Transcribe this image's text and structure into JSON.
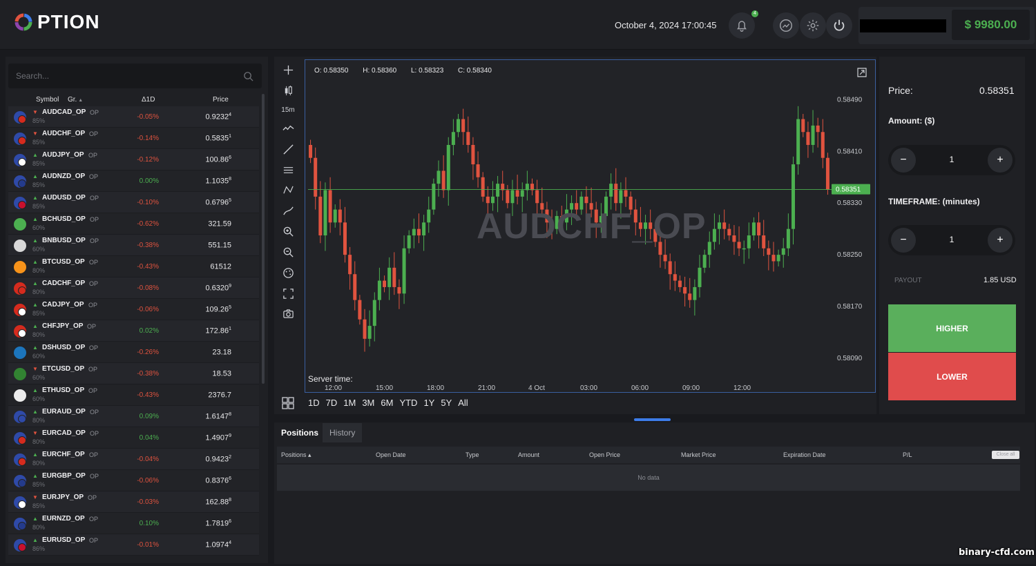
{
  "app": {
    "logo_text": "PTION",
    "datetime": "October 4, 2024 17:00:45",
    "notification_count": "4",
    "balance": "$ 9980.00"
  },
  "search": {
    "placeholder": "Search..."
  },
  "table": {
    "col_symbol": "Symbol",
    "col_group": "Gr.",
    "col_change": "Δ1D",
    "col_price": "Price"
  },
  "assets": [
    {
      "symbol": "AUDCAD_OP",
      "tag": "OP",
      "payout": "85%",
      "dir": "down",
      "change": "-0.05%",
      "price_main": "0.9232",
      "price_sup": "4",
      "flag_a": "#2f4aa8",
      "flag_b": "#d52b1e"
    },
    {
      "symbol": "AUDCHF_OP",
      "tag": "OP",
      "payout": "85%",
      "dir": "down",
      "change": "-0.14%",
      "price_main": "0.5835",
      "price_sup": "1",
      "flag_a": "#2f4aa8",
      "flag_b": "#d52b1e"
    },
    {
      "symbol": "AUDJPY_OP",
      "tag": "OP",
      "payout": "85%",
      "dir": "up",
      "change": "-0.12%",
      "price_main": "100.86",
      "price_sup": "6",
      "flag_a": "#2f4aa8",
      "flag_b": "#ffffff"
    },
    {
      "symbol": "AUDNZD_OP",
      "tag": "OP",
      "payout": "85%",
      "dir": "up",
      "change": "0.00%",
      "price_main": "1.1035",
      "price_sup": "8",
      "flag_a": "#2f4aa8",
      "flag_b": "#243b8c"
    },
    {
      "symbol": "AUDUSD_OP",
      "tag": "OP",
      "payout": "85%",
      "dir": "up",
      "change": "-0.10%",
      "price_main": "0.6796",
      "price_sup": "5",
      "flag_a": "#2f4aa8",
      "flag_b": "#c8102e"
    },
    {
      "symbol": "BCHUSD_OP",
      "tag": "OP",
      "payout": "60%",
      "dir": "up",
      "change": "-0.62%",
      "price_main": "321.59",
      "price_sup": "",
      "flag_a": "#4caf50",
      "flag_b": ""
    },
    {
      "symbol": "BNBUSD_OP",
      "tag": "OP",
      "payout": "60%",
      "dir": "up",
      "change": "-0.38%",
      "price_main": "551.15",
      "price_sup": "",
      "flag_a": "#d8d8d8",
      "flag_b": ""
    },
    {
      "symbol": "BTCUSD_OP",
      "tag": "OP",
      "payout": "80%",
      "dir": "up",
      "change": "-0.43%",
      "price_main": "61512",
      "price_sup": "",
      "flag_a": "#f7931a",
      "flag_b": ""
    },
    {
      "symbol": "CADCHF_OP",
      "tag": "OP",
      "payout": "80%",
      "dir": "up",
      "change": "-0.08%",
      "price_main": "0.6320",
      "price_sup": "9",
      "flag_a": "#d52b1e",
      "flag_b": "#d52b1e"
    },
    {
      "symbol": "CADJPY_OP",
      "tag": "OP",
      "payout": "85%",
      "dir": "up",
      "change": "-0.06%",
      "price_main": "109.26",
      "price_sup": "5",
      "flag_a": "#d52b1e",
      "flag_b": "#ffffff"
    },
    {
      "symbol": "CHFJPY_OP",
      "tag": "OP",
      "payout": "80%",
      "dir": "up",
      "change": "0.02%",
      "price_main": "172.86",
      "price_sup": "1",
      "flag_a": "#d52b1e",
      "flag_b": "#ffffff"
    },
    {
      "symbol": "DSHUSD_OP",
      "tag": "OP",
      "payout": "60%",
      "dir": "up",
      "change": "-0.26%",
      "price_main": "23.18",
      "price_sup": "",
      "flag_a": "#1c75bc",
      "flag_b": ""
    },
    {
      "symbol": "ETCUSD_OP",
      "tag": "OP",
      "payout": "60%",
      "dir": "down",
      "change": "-0.38%",
      "price_main": "18.53",
      "price_sup": "",
      "flag_a": "#328332",
      "flag_b": ""
    },
    {
      "symbol": "ETHUSD_OP",
      "tag": "OP",
      "payout": "60%",
      "dir": "up",
      "change": "-0.43%",
      "price_main": "2376.7",
      "price_sup": "",
      "flag_a": "#ececec",
      "flag_b": ""
    },
    {
      "symbol": "EURAUD_OP",
      "tag": "OP",
      "payout": "80%",
      "dir": "up",
      "change": "0.09%",
      "price_main": "1.6147",
      "price_sup": "8",
      "flag_a": "#2f4aa8",
      "flag_b": "#2f4aa8"
    },
    {
      "symbol": "EURCAD_OP",
      "tag": "OP",
      "payout": "80%",
      "dir": "down",
      "change": "0.04%",
      "price_main": "1.4907",
      "price_sup": "9",
      "flag_a": "#2f4aa8",
      "flag_b": "#d52b1e"
    },
    {
      "symbol": "EURCHF_OP",
      "tag": "OP",
      "payout": "80%",
      "dir": "up",
      "change": "-0.04%",
      "price_main": "0.9423",
      "price_sup": "2",
      "flag_a": "#2f4aa8",
      "flag_b": "#d52b1e"
    },
    {
      "symbol": "EURGBP_OP",
      "tag": "OP",
      "payout": "85%",
      "dir": "up",
      "change": "-0.06%",
      "price_main": "0.8376",
      "price_sup": "6",
      "flag_a": "#2f4aa8",
      "flag_b": "#243b8c"
    },
    {
      "symbol": "EURJPY_OP",
      "tag": "OP",
      "payout": "85%",
      "dir": "down",
      "change": "-0.03%",
      "price_main": "162.88",
      "price_sup": "8",
      "flag_a": "#2f4aa8",
      "flag_b": "#ffffff"
    },
    {
      "symbol": "EURNZD_OP",
      "tag": "OP",
      "payout": "80%",
      "dir": "up",
      "change": "0.10%",
      "price_main": "1.7819",
      "price_sup": "6",
      "flag_a": "#2f4aa8",
      "flag_b": "#243b8c"
    },
    {
      "symbol": "EURUSD_OP",
      "tag": "OP",
      "payout": "86%",
      "dir": "up",
      "change": "-0.01%",
      "price_main": "1.0974",
      "price_sup": "4",
      "flag_a": "#2f4aa8",
      "flag_b": "#c8102e"
    }
  ],
  "chart": {
    "symbol": "AUDCHF_OP",
    "timeframe": "15m",
    "ohlc": {
      "o": "O: 0.58350",
      "h": "H: 0.58360",
      "l": "L: 0.58323",
      "c": "C: 0.58340"
    },
    "server_time_label": "Server time:",
    "ranges": [
      "1D",
      "7D",
      "1M",
      "3M",
      "6M",
      "YTD",
      "1Y",
      "5Y",
      "All"
    ],
    "y_ticks": [
      "0.58490",
      "0.58410",
      "0.58330",
      "0.58250",
      "0.58170",
      "0.58090"
    ],
    "x_ticks": [
      "12:00",
      "15:00",
      "18:00",
      "21:00",
      "4 Oct",
      "03:00",
      "06:00",
      "09:00",
      "12:00"
    ],
    "current_price_label": "0.58351",
    "current_price": 0.58351,
    "y_range": [
      0.5806,
      0.5853
    ],
    "up_color": "#4caf50",
    "down_color": "#e0533f"
  },
  "chart_data": {
    "type": "candlestick",
    "xlabel": "Server time:",
    "ylim": [
      0.5806,
      0.5853
    ],
    "y_ticks": [
      0.5849,
      0.5841,
      0.5833,
      0.5825,
      0.5817,
      0.5809
    ],
    "x_ticks": [
      "12:00",
      "15:00",
      "18:00",
      "21:00",
      "4 Oct",
      "03:00",
      "06:00",
      "09:00",
      "12:00"
    ],
    "last_price": 0.58351,
    "closes": [
      0.584,
      0.5834,
      0.5828,
      0.5835,
      0.583,
      0.5832,
      0.583,
      0.5825,
      0.5822,
      0.5818,
      0.5815,
      0.5812,
      0.5814,
      0.5818,
      0.5821,
      0.582,
      0.5823,
      0.582,
      0.5819,
      0.5826,
      0.5828,
      0.5829,
      0.5828,
      0.583,
      0.5832,
      0.5836,
      0.5838,
      0.5835,
      0.5842,
      0.5844,
      0.5846,
      0.5844,
      0.5842,
      0.5839,
      0.5837,
      0.5834,
      0.5833,
      0.5834,
      0.5836,
      0.5835,
      0.5833,
      0.5835,
      0.5834,
      0.5835,
      0.5836,
      0.5835,
      0.5833,
      0.5832,
      0.583,
      0.5829,
      0.5831,
      0.583,
      0.5832,
      0.5833,
      0.5832,
      0.5834,
      0.5833,
      0.5832,
      0.583,
      0.5831,
      0.5834,
      0.5836,
      0.5833,
      0.5835,
      0.5834,
      0.5832,
      0.583,
      0.5829,
      0.583,
      0.5829,
      0.5827,
      0.5825,
      0.5824,
      0.5822,
      0.5821,
      0.582,
      0.5819,
      0.5818,
      0.582,
      0.5823,
      0.5825,
      0.5827,
      0.5829,
      0.583,
      0.5829,
      0.5828,
      0.5827,
      0.5826,
      0.5826,
      0.5828,
      0.583,
      0.5828,
      0.5826,
      0.5825,
      0.5824,
      0.5825,
      0.5826,
      0.5829,
      0.5839,
      0.5846,
      0.5844,
      0.5842,
      0.5845,
      0.5844,
      0.584,
      0.58351
    ]
  },
  "trade": {
    "price_label": "Price:",
    "price_value": "0.58351",
    "amount_label": "Amount: ($)",
    "amount_value": "1",
    "timeframe_label": "TIMEFRAME: (minutes)",
    "timeframe_value": "1",
    "payout_label": "PAYOUT",
    "payout_value": "1.85 USD",
    "higher_label": "HIGHER",
    "lower_label": "LOWER",
    "minus": "−",
    "plus": "+"
  },
  "positions": {
    "tab_positions": "Positions",
    "tab_history": "History",
    "columns": [
      "Positions ▴",
      "Open Date",
      "Type",
      "Amount",
      "Open Price",
      "Market Price",
      "Expiration Date",
      "P/L"
    ],
    "close_all": "Close all",
    "empty": "No data"
  },
  "site_watermark": "binary-cfd.com"
}
